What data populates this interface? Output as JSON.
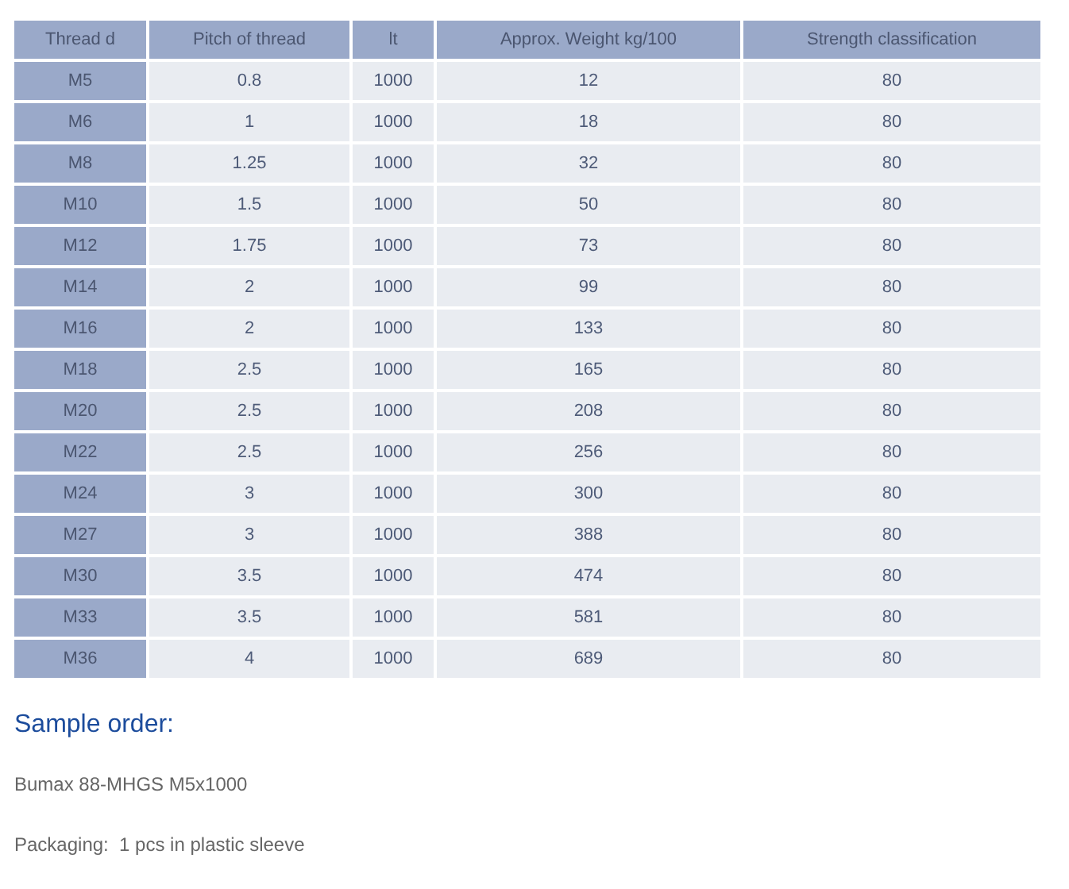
{
  "table": {
    "columns": [
      "Thread d",
      "Pitch of thread",
      "lt",
      "Approx. Weight kg/100",
      "Strength classification"
    ],
    "rows": [
      [
        "M5",
        "0.8",
        "1000",
        "12",
        "80"
      ],
      [
        "M6",
        "1",
        "1000",
        "18",
        "80"
      ],
      [
        "M8",
        "1.25",
        "1000",
        "32",
        "80"
      ],
      [
        "M10",
        "1.5",
        "1000",
        "50",
        "80"
      ],
      [
        "M12",
        "1.75",
        "1000",
        "73",
        "80"
      ],
      [
        "M14",
        "2",
        "1000",
        "99",
        "80"
      ],
      [
        "M16",
        "2",
        "1000",
        "133",
        "80"
      ],
      [
        "M18",
        "2.5",
        "1000",
        "165",
        "80"
      ],
      [
        "M20",
        "2.5",
        "1000",
        "208",
        "80"
      ],
      [
        "M22",
        "2.5",
        "1000",
        "256",
        "80"
      ],
      [
        "M24",
        "3",
        "1000",
        "300",
        "80"
      ],
      [
        "M27",
        "3",
        "1000",
        "388",
        "80"
      ],
      [
        "M30",
        "3.5",
        "1000",
        "474",
        "80"
      ],
      [
        "M33",
        "3.5",
        "1000",
        "581",
        "80"
      ],
      [
        "M36",
        "4",
        "1000",
        "689",
        "80"
      ]
    ]
  },
  "sample_order": {
    "heading": "Sample order:",
    "example": "Bumax 88-MHGS M5x1000",
    "packaging": "Packaging:  1 pcs in plastic sleeve"
  }
}
